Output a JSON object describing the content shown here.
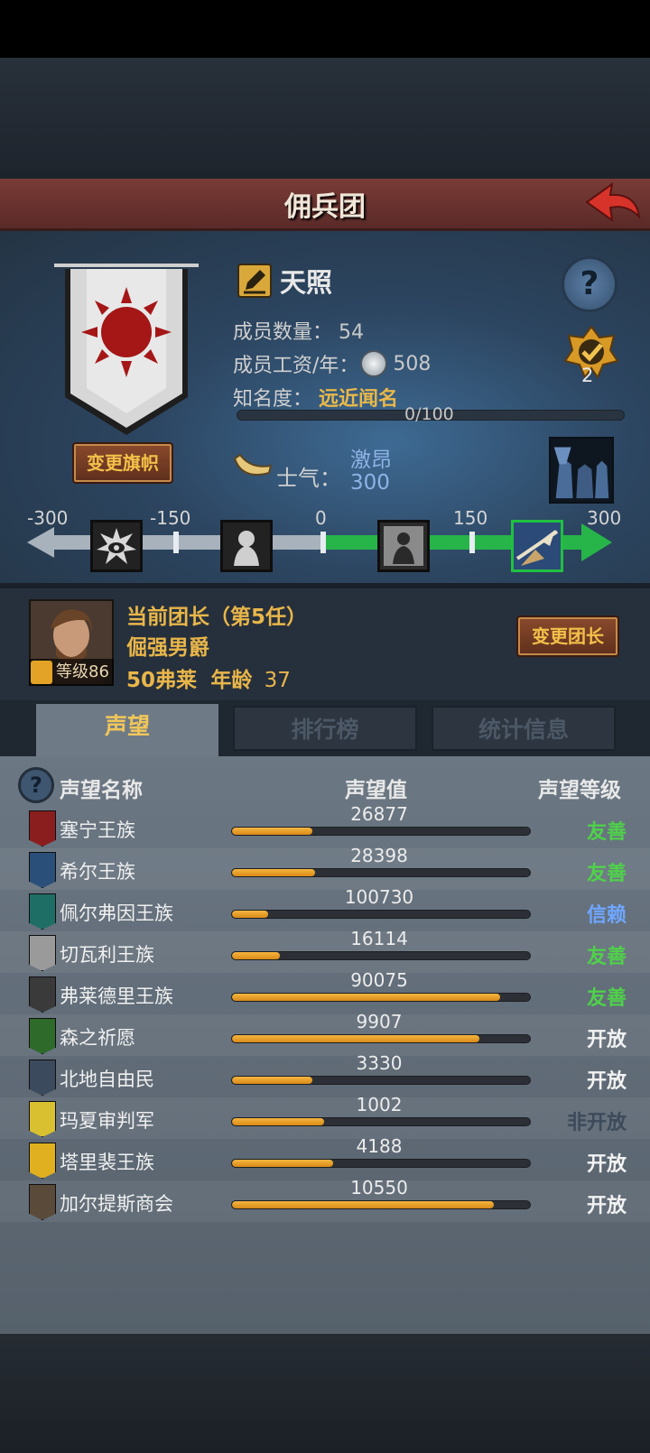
{
  "header": {
    "title": "佣兵团"
  },
  "company": {
    "name": "天照",
    "members_label": "成员数量：",
    "members": "54",
    "wage_label": "成员工资/年：",
    "wage": "508",
    "fame_label": "知名度：",
    "fame_rank": "远近闻名",
    "fame_progress_text": "0/100",
    "fame_progress": 0,
    "banner_button": "变更旗帜",
    "badge_count": "2"
  },
  "morale": {
    "label": "士气：",
    "word": "激昂",
    "value": "300",
    "scale": [
      "-300",
      "-150",
      "0",
      "150",
      "300"
    ]
  },
  "leader": {
    "title": "当前团长（第5任）",
    "name": "倔强男爵",
    "level": "等级86",
    "money": "50弗莱",
    "age_label": "年龄",
    "age": "37",
    "change_button": "变更团长"
  },
  "tabs": [
    {
      "label": "声望",
      "active": true
    },
    {
      "label": "排行榜",
      "active": false
    },
    {
      "label": "统计信息",
      "active": false
    }
  ],
  "columns": {
    "name": "声望名称",
    "value": "声望值",
    "level": "声望等级"
  },
  "colors": {
    "friendly": "#4fd14a",
    "trust": "#6fa6ff",
    "open": "#f2f2f2",
    "closed": "#3c4a5a"
  },
  "factions": [
    {
      "name": "塞宁王族",
      "value": "26877",
      "progress": 0.27,
      "level": "友善",
      "level_type": "friendly",
      "icon_color": "#8a1e1e"
    },
    {
      "name": "希尔王族",
      "value": "28398",
      "progress": 0.28,
      "level": "友善",
      "level_type": "friendly",
      "icon_color": "#2a4f78"
    },
    {
      "name": "佩尔弗因王族",
      "value": "100730",
      "progress": 0.12,
      "level": "信赖",
      "level_type": "trust",
      "icon_color": "#1e6e66"
    },
    {
      "name": "切瓦利王族",
      "value": "16114",
      "progress": 0.16,
      "level": "友善",
      "level_type": "friendly",
      "icon_color": "#9a9a9a"
    },
    {
      "name": "弗莱德里王族",
      "value": "90075",
      "progress": 0.9,
      "level": "友善",
      "level_type": "friendly",
      "icon_color": "#3a3a3a"
    },
    {
      "name": "森之祈愿",
      "value": "9907",
      "progress": 0.83,
      "level": "开放",
      "level_type": "open",
      "icon_color": "#2e6a2a"
    },
    {
      "name": "北地自由民",
      "value": "3330",
      "progress": 0.27,
      "level": "开放",
      "level_type": "open",
      "icon_color": "#3c4a5e"
    },
    {
      "name": "玛夏审判军",
      "value": "1002",
      "progress": 0.31,
      "level": "非开放",
      "level_type": "closed",
      "icon_color": "#d8c030"
    },
    {
      "name": "塔里裴王族",
      "value": "4188",
      "progress": 0.34,
      "level": "开放",
      "level_type": "open",
      "icon_color": "#e0b020"
    },
    {
      "name": "加尔提斯商会",
      "value": "10550",
      "progress": 0.88,
      "level": "开放",
      "level_type": "open",
      "icon_color": "#5a4a3a"
    }
  ]
}
